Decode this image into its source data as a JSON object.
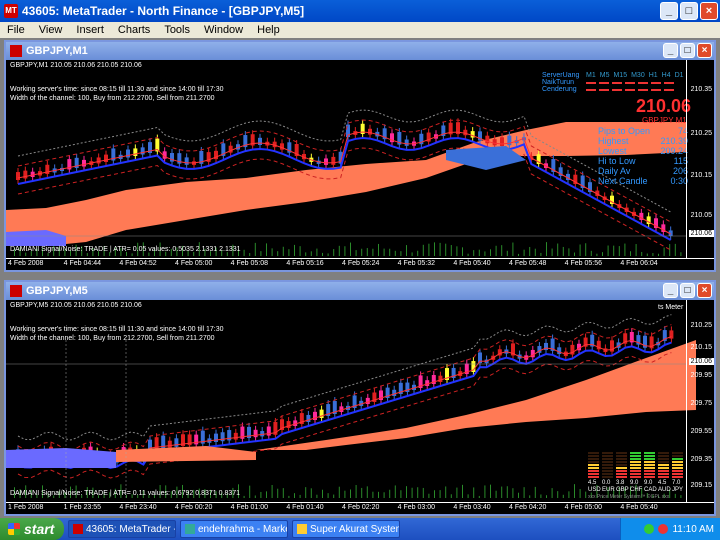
{
  "app": {
    "title": "43605: MetaTrader - North Finance - [GBPJPY,M5]"
  },
  "menu": [
    "File",
    "View",
    "Insert",
    "Charts",
    "Tools",
    "Window",
    "Help"
  ],
  "top_chart": {
    "window_title": "GBPJPY,M1",
    "header": "GBPJPY,M1  210.05 210.06 210.05 210.06",
    "info1": "Working server's time: since 08:15 till 11:30 and since 14:00 till 17:30",
    "info2": "Width of the channel: 100, Buy from 212.2700, Sell from 211.2700",
    "indicator": "DAMIANI Signal/Noise: TRADE  |  ATR= 0.05    values: 0.5035 2.1331 2.1331",
    "price_big": "210.06",
    "pair_label": "GBPJPY M1",
    "stats": [
      {
        "label": "Pips to Open",
        "value": "74"
      },
      {
        "label": "Highest",
        "value": "210.39"
      },
      {
        "label": "Lowest",
        "value": "209.24"
      },
      {
        "label": "Hi to Low",
        "value": "115"
      },
      {
        "label": "Daily Av",
        "value": "206"
      },
      {
        "label": "Next Candle",
        "value": "0:30"
      }
    ],
    "panel_rows": [
      "ServerUang",
      "NaikTurun",
      "Cenderung"
    ],
    "panel_cols": [
      "M1",
      "M5",
      "M15",
      "M30",
      "H1",
      "H4",
      "D1"
    ],
    "y_ticks": [
      "210.35",
      "210.25",
      "210.15",
      "210.05",
      "210.06"
    ],
    "x_ticks": [
      "4 Feb 2008",
      "4 Feb 04:44",
      "4 Feb 04:52",
      "4 Feb 05:00",
      "4 Feb 05:08",
      "4 Feb 05:16",
      "4 Feb 05:24",
      "4 Feb 05:32",
      "4 Feb 05:40",
      "4 Feb 05:48",
      "4 Feb 05:56",
      "4 Feb 06:04"
    ]
  },
  "bottom_chart": {
    "window_title": "GBPJPY,M5",
    "header": "GBPJPY,M5  210.05 210.06 210.05 210.06",
    "info1": "Working server's time: since 08:15 till 11:30 and since 14:00 till 17:30",
    "info2": "Width of the channel: 100, Buy from 212.2700, Sell from 211.2700",
    "indicator": "DAMIANI Signal/Noise: TRADE  |  ATR= 0.11    values: 0.6792 0.8371 0.8371",
    "meter_title": "ts Meter",
    "meter_values": [
      "4.5",
      "0.0",
      "3.8",
      "9.0",
      "9.0",
      "4.5",
      "7.0"
    ],
    "meter_currencies": [
      "USD",
      "EUR",
      "GBP",
      "CHF",
      "CAD",
      "AUD",
      "JPY"
    ],
    "meter_levels": [
      5,
      0,
      4,
      9,
      9,
      5,
      7
    ],
    "meter_footer": "xxx Price Meter System™ ©GPL xxx",
    "y_ticks": [
      "210.25",
      "210.15",
      "210.06",
      "209.95",
      "209.75",
      "209.55",
      "209.35",
      "209.15"
    ],
    "x_ticks": [
      "1 Feb 2008",
      "1 Feb 23:55",
      "4 Feb 23:40",
      "4 Feb 00:20",
      "4 Feb 01:00",
      "4 Feb 01:40",
      "4 Feb 02:20",
      "4 Feb 03:00",
      "4 Feb 03:40",
      "4 Feb 04:20",
      "4 Feb 05:00",
      "4 Feb 05:40"
    ]
  },
  "taskbar": {
    "start": "start",
    "items": [
      "43605: MetaTrader - ...",
      "endehrahma - Market...",
      "Super Akurat System"
    ],
    "clock": "11:10 AM"
  }
}
